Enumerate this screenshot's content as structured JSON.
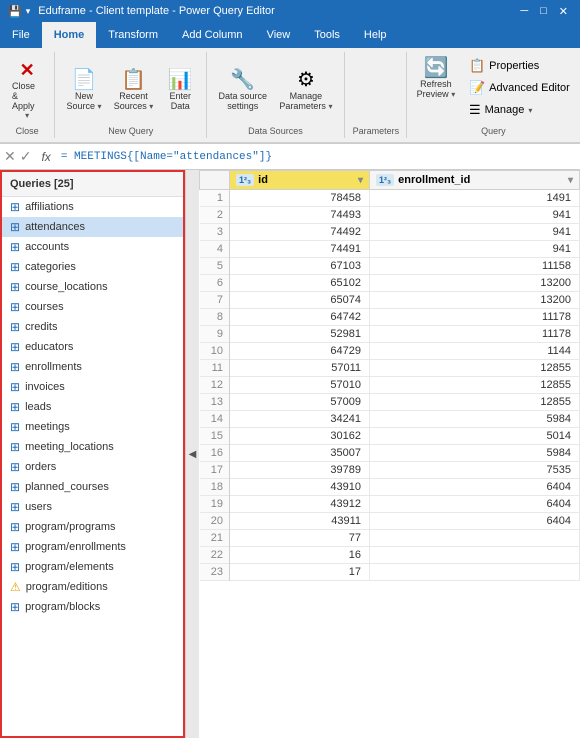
{
  "titleBar": {
    "text": "Eduframe - Client template - Power Query Editor",
    "saveIcon": "💾",
    "quickSave": "▾"
  },
  "ribbonTabs": [
    "File",
    "Home",
    "Transform",
    "Add Column",
    "View",
    "Tools",
    "Help"
  ],
  "activeTab": "Home",
  "ribbonGroups": {
    "close": {
      "label": "Close",
      "buttons": [
        {
          "id": "close-apply",
          "icon": "✕",
          "label": "Close &\nApply",
          "hasArrow": true
        }
      ]
    },
    "newQuery": {
      "label": "New Query",
      "buttons": [
        {
          "id": "new-source",
          "icon": "📄",
          "label": "New\nSource",
          "hasArrow": true
        },
        {
          "id": "recent-sources",
          "icon": "📋",
          "label": "Recent\nSources",
          "hasArrow": true
        },
        {
          "id": "enter-data",
          "icon": "📊",
          "label": "Enter\nData"
        }
      ]
    },
    "dataSources": {
      "label": "Data Sources",
      "buttons": [
        {
          "id": "data-source-settings",
          "icon": "🔧",
          "label": "Data source\nsettings"
        },
        {
          "id": "manage-parameters",
          "icon": "⚙",
          "label": "Manage\nParameters",
          "hasArrow": true
        }
      ]
    },
    "parameters": {
      "label": "Parameters",
      "buttons": []
    },
    "query": {
      "label": "Query",
      "buttons": [
        {
          "id": "refresh-preview",
          "icon": "🔄",
          "label": "Refresh\nPreview",
          "hasArrow": true
        }
      ],
      "smallButtons": [
        {
          "id": "properties",
          "icon": "📋",
          "label": "Properties"
        },
        {
          "id": "advanced-editor",
          "icon": "📝",
          "label": "Advanced Editor"
        },
        {
          "id": "manage",
          "icon": "☰",
          "label": "Manage",
          "hasArrow": true
        }
      ]
    }
  },
  "formulaBar": {
    "cancelIcon": "✕",
    "confirmIcon": "✓",
    "fx": "fx",
    "formula": "= MEETINGS{[Name=\"attendances\"]}"
  },
  "sidebar": {
    "header": "Queries [25]",
    "items": [
      {
        "id": "affiliations",
        "label": "affiliations",
        "icon": "🔲",
        "type": "table",
        "warning": false
      },
      {
        "id": "attendances",
        "label": "attendances",
        "icon": "🔲",
        "type": "table",
        "warning": false,
        "active": true
      },
      {
        "id": "accounts",
        "label": "accounts",
        "icon": "🔲",
        "type": "table",
        "warning": false
      },
      {
        "id": "categories",
        "label": "categories",
        "icon": "🔲",
        "type": "table",
        "warning": false
      },
      {
        "id": "course_locations",
        "label": "course_locations",
        "icon": "🔲",
        "type": "table",
        "warning": false
      },
      {
        "id": "courses",
        "label": "courses",
        "icon": "🔲",
        "type": "table",
        "warning": false
      },
      {
        "id": "credits",
        "label": "credits",
        "icon": "🔲",
        "type": "table",
        "warning": false
      },
      {
        "id": "educators",
        "label": "educators",
        "icon": "🔲",
        "type": "table",
        "warning": false
      },
      {
        "id": "enrollments",
        "label": "enrollments",
        "icon": "🔲",
        "type": "table",
        "warning": false
      },
      {
        "id": "invoices",
        "label": "invoices",
        "icon": "🔲",
        "type": "table",
        "warning": false
      },
      {
        "id": "leads",
        "label": "leads",
        "icon": "🔲",
        "type": "table",
        "warning": false
      },
      {
        "id": "meetings",
        "label": "meetings",
        "icon": "🔲",
        "type": "table",
        "warning": false
      },
      {
        "id": "meeting_locations",
        "label": "meeting_locations",
        "icon": "🔲",
        "type": "table",
        "warning": false
      },
      {
        "id": "orders",
        "label": "orders",
        "icon": "🔲",
        "type": "table",
        "warning": false
      },
      {
        "id": "planned_courses",
        "label": "planned_courses",
        "icon": "🔲",
        "type": "table",
        "warning": false
      },
      {
        "id": "users",
        "label": "users",
        "icon": "🔲",
        "type": "table",
        "warning": false
      },
      {
        "id": "program-programs",
        "label": "program/programs",
        "icon": "🔲",
        "type": "table",
        "warning": false
      },
      {
        "id": "program-enrollments",
        "label": "program/enrollments",
        "icon": "🔲",
        "type": "table",
        "warning": false
      },
      {
        "id": "program-elements",
        "label": "program/elements",
        "icon": "🔲",
        "type": "table",
        "warning": false
      },
      {
        "id": "program-editions",
        "label": "program/editions",
        "icon": "🔲",
        "type": "table",
        "warning": true
      },
      {
        "id": "program-blocks",
        "label": "program/blocks",
        "icon": "🔲",
        "type": "table",
        "warning": false
      }
    ]
  },
  "grid": {
    "columns": [
      {
        "id": "col-id",
        "type": "1²₃",
        "label": "id",
        "isHighlighted": true
      },
      {
        "id": "col-enrollment-id",
        "type": "1²₃",
        "label": "enrollment_id"
      }
    ],
    "rows": [
      {
        "num": 1,
        "id": 78458,
        "enrollment_id": 1491
      },
      {
        "num": 2,
        "id": 74493,
        "enrollment_id": 941
      },
      {
        "num": 3,
        "id": 74492,
        "enrollment_id": 941
      },
      {
        "num": 4,
        "id": 74491,
        "enrollment_id": 941
      },
      {
        "num": 5,
        "id": 67103,
        "enrollment_id": 11158
      },
      {
        "num": 6,
        "id": 65102,
        "enrollment_id": 13200
      },
      {
        "num": 7,
        "id": 65074,
        "enrollment_id": 13200
      },
      {
        "num": 8,
        "id": 64742,
        "enrollment_id": 11178
      },
      {
        "num": 9,
        "id": 52981,
        "enrollment_id": 11178
      },
      {
        "num": 10,
        "id": 64729,
        "enrollment_id": 1144
      },
      {
        "num": 11,
        "id": 57011,
        "enrollment_id": 12855
      },
      {
        "num": 12,
        "id": 57010,
        "enrollment_id": 12855
      },
      {
        "num": 13,
        "id": 57009,
        "enrollment_id": 12855
      },
      {
        "num": 14,
        "id": 34241,
        "enrollment_id": 5984
      },
      {
        "num": 15,
        "id": 30162,
        "enrollment_id": 5014
      },
      {
        "num": 16,
        "id": 35007,
        "enrollment_id": 5984
      },
      {
        "num": 17,
        "id": 39789,
        "enrollment_id": 7535
      },
      {
        "num": 18,
        "id": 43910,
        "enrollment_id": 6404
      },
      {
        "num": 19,
        "id": 43912,
        "enrollment_id": 6404
      },
      {
        "num": 20,
        "id": 43911,
        "enrollment_id": 6404
      },
      {
        "num": 21,
        "id": 77,
        "enrollment_id": null
      },
      {
        "num": 22,
        "id": 16,
        "enrollment_id": null
      },
      {
        "num": 23,
        "id": 17,
        "enrollment_id": null
      }
    ]
  }
}
